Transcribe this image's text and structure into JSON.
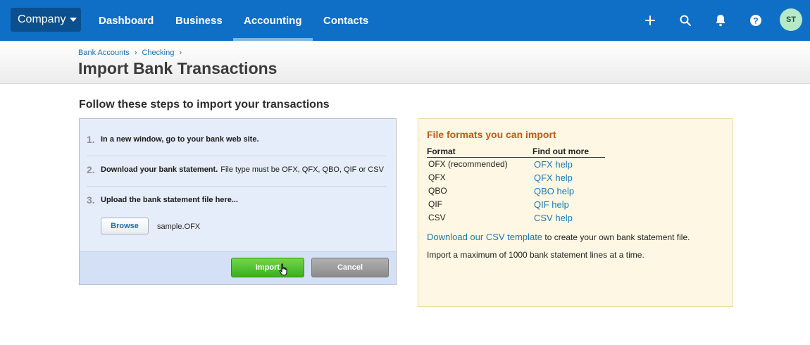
{
  "nav": {
    "company_label": "Company",
    "items": [
      {
        "label": "Dashboard"
      },
      {
        "label": "Business"
      },
      {
        "label": "Accounting"
      },
      {
        "label": "Contacts"
      }
    ],
    "active": "Accounting",
    "avatar_initials": "ST",
    "icons": [
      "plus-icon",
      "search-icon",
      "bell-icon",
      "help-icon"
    ]
  },
  "breadcrumb": [
    "Bank Accounts",
    "Checking"
  ],
  "page_title": "Import Bank Transactions",
  "section_title": "Follow these steps to import your transactions",
  "steps": [
    {
      "num": "1.",
      "bold": "In a new window, go to your bank web site.",
      "rest": ""
    },
    {
      "num": "2.",
      "bold": "Download your bank statement.",
      "rest": "File type must be OFX, QFX, QBO, QIF or CSV"
    },
    {
      "num": "3.",
      "bold": "Upload the bank statement file here...",
      "rest": ""
    }
  ],
  "upload": {
    "browse_label": "Browse",
    "file_name": "sample.OFX"
  },
  "actions": {
    "import_label": "Import",
    "cancel_label": "Cancel"
  },
  "formats": {
    "title": "File formats you can import",
    "col_format": "Format",
    "col_help": "Find out more",
    "rows": [
      {
        "format": "OFX (recommended)",
        "help": "OFX help"
      },
      {
        "format": "QFX",
        "help": "QFX help"
      },
      {
        "format": "QBO",
        "help": "QBO help"
      },
      {
        "format": "QIF",
        "help": "QIF help"
      },
      {
        "format": "CSV",
        "help": "CSV help"
      }
    ],
    "csv_link": "Download our CSV template",
    "csv_rest": " to create your own bank statement file.",
    "max_note": "Import a maximum of 1000 bank statement lines at a time."
  },
  "colors": {
    "nav_bg": "#0f6fc6",
    "accent_orange": "#c4571a",
    "link_blue": "#1a7ab8",
    "import_green": "#3cae1f"
  }
}
